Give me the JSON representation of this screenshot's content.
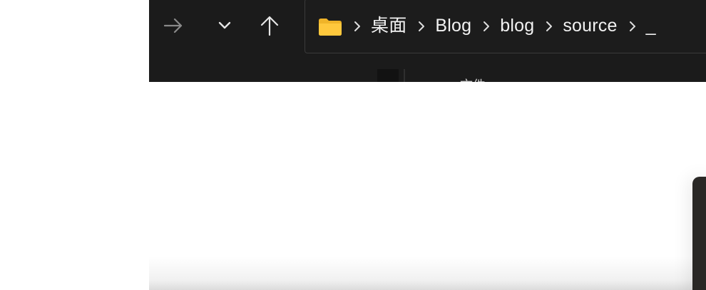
{
  "toolbar": {
    "forward_icon": "arrow-right-icon",
    "recent_icon": "chevron-down-icon",
    "up_icon": "arrow-up-icon"
  },
  "address_bar": {
    "folder_icon": "folder-icon",
    "folder_color": "#FFC83D",
    "crumbs": [
      "桌面",
      "Blog",
      "blog",
      "source"
    ],
    "trailing_partial": "_"
  },
  "pane": {
    "partial_label": "文件"
  },
  "colors": {
    "chrome_background": "#1B1B1B",
    "text": "#F2F2F2"
  }
}
